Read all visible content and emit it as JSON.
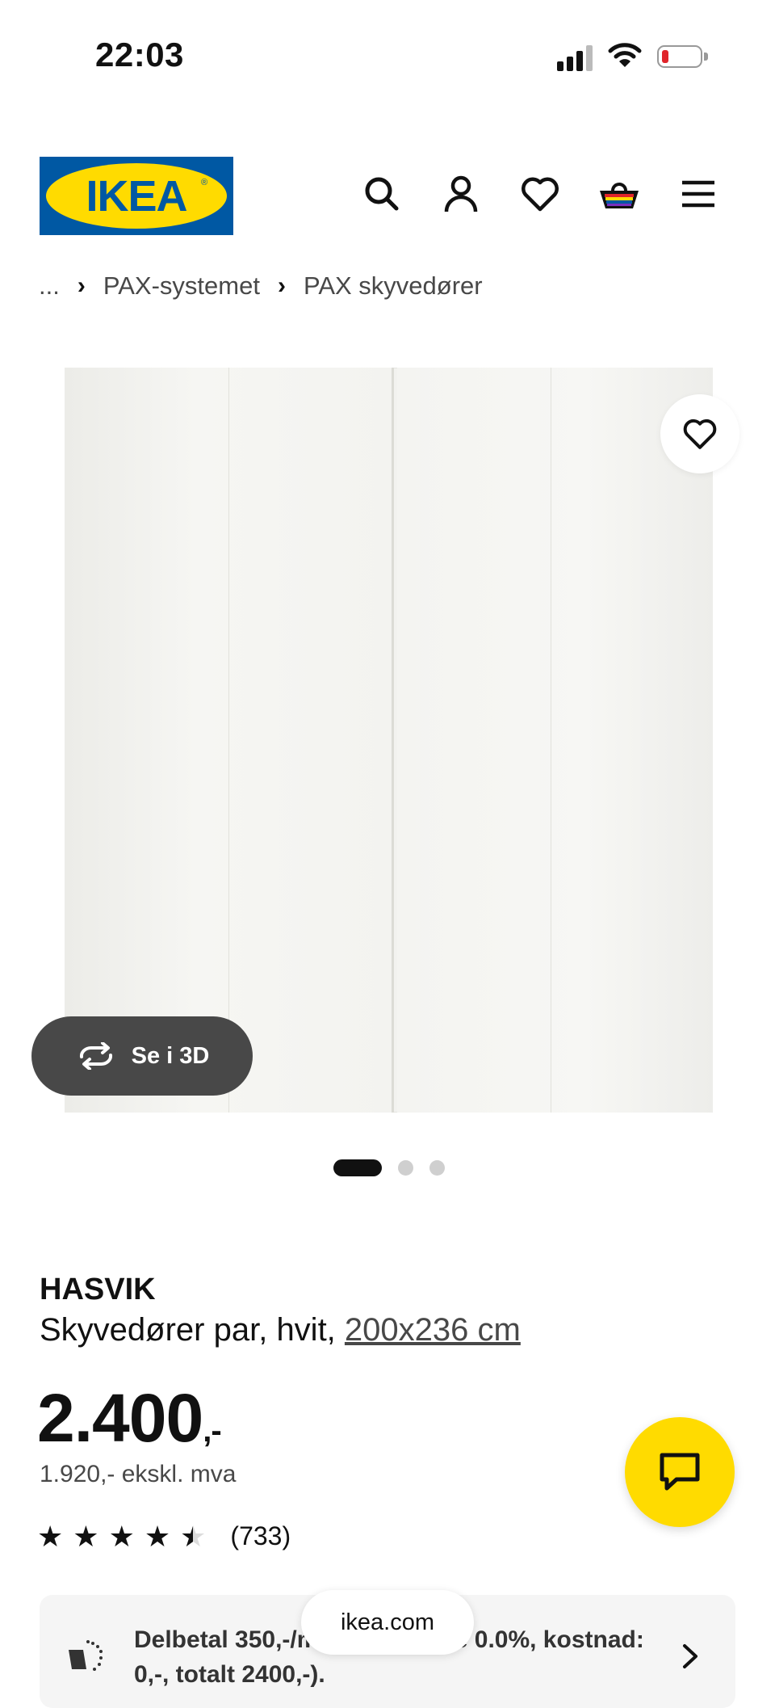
{
  "status_bar": {
    "time": "22:03",
    "battery_level": 0.1
  },
  "header": {
    "logo_text": "IKEA",
    "icons": [
      "search-icon",
      "account-icon",
      "heart-icon",
      "basket-icon",
      "menu-icon"
    ]
  },
  "breadcrumb": {
    "ellipsis": "...",
    "items": [
      "PAX-systemet",
      "PAX skyvedører"
    ]
  },
  "gallery": {
    "button_3d": "Se i 3D",
    "slide_count": 3,
    "active_slide": 1
  },
  "product": {
    "name": "HASVIK",
    "description": "Skyvedører par, hvit, ",
    "size": "200x236 cm",
    "price": "2.400",
    "price_suffix": ",-",
    "price_ex_vat": "1.920,- ekskl. mva",
    "rating": 4.5,
    "rating_count": "(733)"
  },
  "installment": {
    "text": "Delbetal 350,-/mnd (Eff. rente 0.0%, kostnad: 0,-, totalt 2400,-)."
  },
  "browser": {
    "url": "ikea.com"
  },
  "colors": {
    "ikea_blue": "#0058a3",
    "ikea_yellow": "#ffdb00",
    "dark_button": "#484848"
  }
}
